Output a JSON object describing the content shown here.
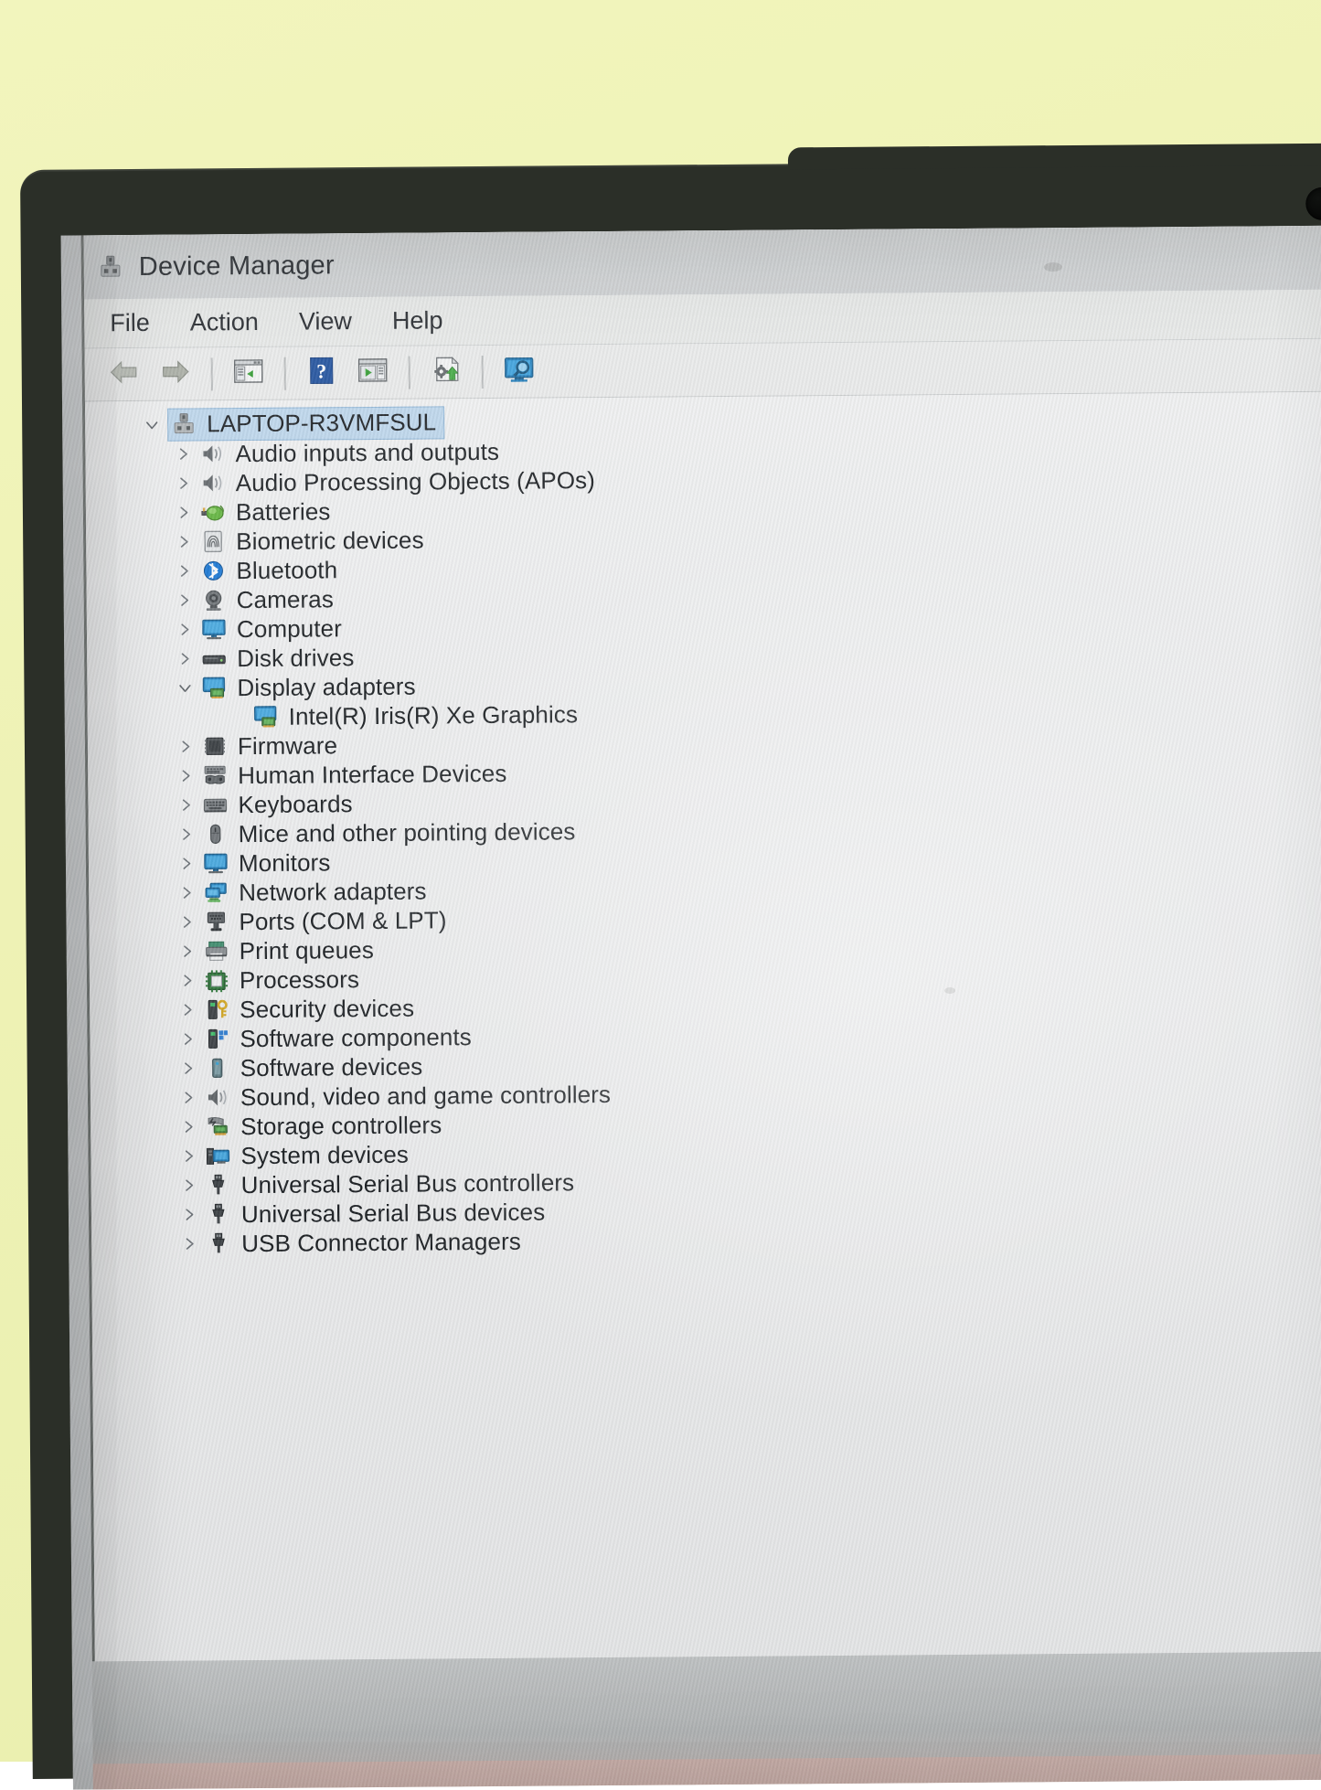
{
  "window": {
    "title": "Device Manager",
    "title_icon": "device-manager-icon"
  },
  "menubar": {
    "items": [
      {
        "label": "File"
      },
      {
        "label": "Action"
      },
      {
        "label": "View"
      },
      {
        "label": "Help"
      }
    ]
  },
  "toolbar": {
    "buttons": [
      {
        "name": "back-button",
        "icon": "back-arrow-icon",
        "label": "Back"
      },
      {
        "name": "forward-button",
        "icon": "forward-arrow-icon",
        "label": "Forward"
      },
      {
        "name": "show-properties-button",
        "icon": "properties-window-icon",
        "label": "Properties"
      },
      {
        "name": "help-button",
        "icon": "help-question-icon",
        "label": "Help"
      },
      {
        "name": "update-driver-button",
        "icon": "window-play-icon",
        "label": "Update driver"
      },
      {
        "name": "scan-hardware-changes-button",
        "icon": "gear-upload-icon",
        "label": "Scan for hardware changes"
      },
      {
        "name": "show-hidden-devices-button",
        "icon": "monitor-magnifier-icon",
        "label": "Show hidden devices"
      }
    ]
  },
  "tree": {
    "root": {
      "label": "LAPTOP-R3VMFSUL",
      "icon": "computer-node-icon",
      "expanded": true,
      "selected": true
    },
    "nodes": [
      {
        "label": "Audio inputs and outputs",
        "icon": "speaker-icon",
        "expanded": false,
        "depth": 1
      },
      {
        "label": "Audio Processing Objects (APOs)",
        "icon": "speaker-icon",
        "expanded": false,
        "depth": 1
      },
      {
        "label": "Batteries",
        "icon": "battery-icon",
        "expanded": false,
        "depth": 1
      },
      {
        "label": "Biometric devices",
        "icon": "fingerprint-icon",
        "expanded": false,
        "depth": 1
      },
      {
        "label": "Bluetooth",
        "icon": "bluetooth-icon",
        "expanded": false,
        "depth": 1
      },
      {
        "label": "Cameras",
        "icon": "webcam-icon",
        "expanded": false,
        "depth": 1
      },
      {
        "label": "Computer",
        "icon": "monitor-icon",
        "expanded": false,
        "depth": 1
      },
      {
        "label": "Disk drives",
        "icon": "disk-drive-icon",
        "expanded": false,
        "depth": 1
      },
      {
        "label": "Display adapters",
        "icon": "display-adapter-icon",
        "expanded": true,
        "depth": 1
      },
      {
        "label": "Intel(R) Iris(R) Xe Graphics",
        "icon": "display-adapter-icon",
        "expanded": null,
        "depth": 2
      },
      {
        "label": "Firmware",
        "icon": "firmware-chip-icon",
        "expanded": false,
        "depth": 1
      },
      {
        "label": "Human Interface Devices",
        "icon": "hid-icon",
        "expanded": false,
        "depth": 1
      },
      {
        "label": "Keyboards",
        "icon": "keyboard-icon",
        "expanded": false,
        "depth": 1
      },
      {
        "label": "Mice and other pointing devices",
        "icon": "mouse-icon",
        "expanded": false,
        "depth": 1
      },
      {
        "label": "Monitors",
        "icon": "monitor-icon",
        "expanded": false,
        "depth": 1
      },
      {
        "label": "Network adapters",
        "icon": "network-adapter-icon",
        "expanded": false,
        "depth": 1
      },
      {
        "label": "Ports (COM & LPT)",
        "icon": "port-connector-icon",
        "expanded": false,
        "depth": 1
      },
      {
        "label": "Print queues",
        "icon": "printer-icon",
        "expanded": false,
        "depth": 1
      },
      {
        "label": "Processors",
        "icon": "processor-icon",
        "expanded": false,
        "depth": 1
      },
      {
        "label": "Security devices",
        "icon": "security-key-icon",
        "expanded": false,
        "depth": 1
      },
      {
        "label": "Software components",
        "icon": "software-component-icon",
        "expanded": false,
        "depth": 1
      },
      {
        "label": "Software devices",
        "icon": "software-device-icon",
        "expanded": false,
        "depth": 1
      },
      {
        "label": "Sound, video and game controllers",
        "icon": "speaker-icon",
        "expanded": false,
        "depth": 1
      },
      {
        "label": "Storage controllers",
        "icon": "storage-controller-icon",
        "expanded": false,
        "depth": 1
      },
      {
        "label": "System devices",
        "icon": "system-device-icon",
        "expanded": false,
        "depth": 1
      },
      {
        "label": "Universal Serial Bus controllers",
        "icon": "usb-icon",
        "expanded": false,
        "depth": 1
      },
      {
        "label": "Universal Serial Bus devices",
        "icon": "usb-icon",
        "expanded": false,
        "depth": 1
      },
      {
        "label": "USB Connector Managers",
        "icon": "usb-icon",
        "expanded": false,
        "depth": 1
      }
    ]
  },
  "colors": {
    "window_bg": "#eff0f1",
    "titlebar_bg": "#cfd2d4",
    "selection_bg": "#bcd6ec",
    "selection_border": "#8db4d6",
    "accent_blue": "#0a6fc2",
    "bezel": "#2b2f28",
    "wall": "#eef2b5"
  },
  "chevrons": {
    "collapsed": "❯",
    "expanded": "❯"
  }
}
